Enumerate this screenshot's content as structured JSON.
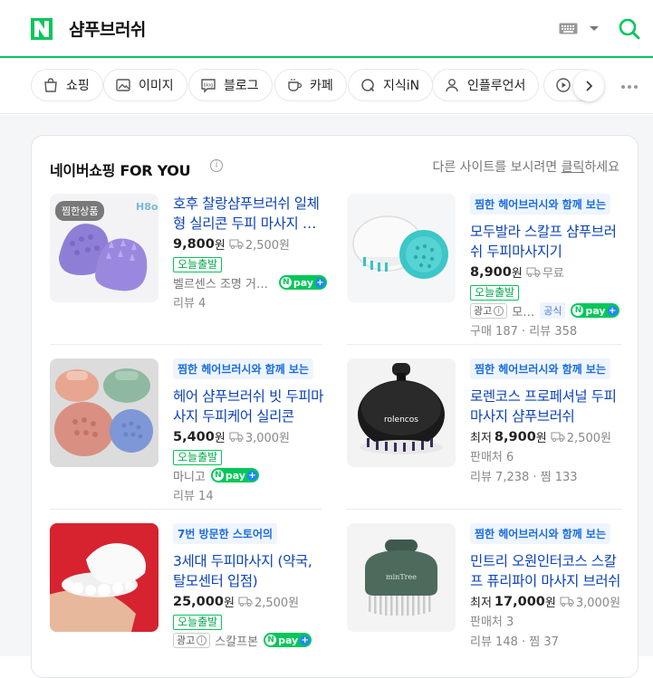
{
  "header": {
    "logo_letter": "N",
    "query": "샴푸브러쉬",
    "icons": [
      "keyboard-icon",
      "chevron-down-icon",
      "search-icon"
    ],
    "brand_color": "#03c75a"
  },
  "tabs": [
    {
      "label": "쇼핑",
      "icon": "shopping-bag-icon"
    },
    {
      "label": "이미지",
      "icon": "image-icon"
    },
    {
      "label": "블로그",
      "icon": "blog-icon"
    },
    {
      "label": "카페",
      "icon": "cafe-icon"
    },
    {
      "label": "지식iN",
      "icon": "kin-icon"
    },
    {
      "label": "인플루언서",
      "icon": "person-icon"
    },
    {
      "label": "",
      "icon": "play-icon"
    }
  ],
  "card": {
    "title": "네이버쇼핑 FOR YOU",
    "note_prefix": "다른 사이트를 보시려면 ",
    "note_link": "클릭",
    "note_suffix": "하세요"
  },
  "products": [
    {
      "thumb_badge": "찜한상품",
      "tagline": "",
      "title": "호후 찰랑샴푸브러쉬 일체형 실리콘 두피 마사지 샴푸브러쉬",
      "price_prefix": "",
      "price": "9,800",
      "won": "원",
      "shipping": "2,500원",
      "badge": "오늘출발",
      "ad": false,
      "seller": "벨르센스 조명 거실등",
      "official": "",
      "npay": true,
      "sub1": "리뷰 4",
      "sub2": ""
    },
    {
      "thumb_badge": "",
      "tagline": "찜한 헤어브러시와 함께 보는",
      "title": "모두발라 스칼프 샴푸브러쉬 두피마사지기",
      "price_prefix": "",
      "price": "8,900",
      "won": "원",
      "shipping": "무료",
      "badge": "오늘출발",
      "ad": true,
      "ad_label": "광고",
      "seller": "모…",
      "official": "공식",
      "npay": true,
      "sub1": "구매 187 · 리뷰 358",
      "sub2": ""
    },
    {
      "thumb_badge": "",
      "tagline": "찜한 헤어브러시와 함께 보는",
      "title": "헤어 샴푸브러쉬 빗 두피마사지 두피케어 실리콘",
      "price_prefix": "",
      "price": "5,400",
      "won": "원",
      "shipping": "3,000원",
      "badge": "오늘출발",
      "ad": false,
      "seller": "마니고",
      "official": "",
      "npay": true,
      "sub1": "리뷰 14",
      "sub2": ""
    },
    {
      "thumb_badge": "",
      "tagline": "찜한 헤어브러시와 함께 보는",
      "title": "로렌코스 프로페셔널 두피 마사지 샴푸브러쉬",
      "price_prefix": "최저",
      "price": "8,900",
      "won": "원",
      "shipping": "2,500원",
      "badge": "",
      "ad": false,
      "seller": "",
      "official": "",
      "npay": false,
      "sub1": "판매처 6",
      "sub2": "리뷰 7,238 · 찜 133"
    },
    {
      "thumb_badge": "",
      "tagline": "7번 방문한 스토어의",
      "title": "3세대 두피마사지 (약국, 탈모센터 입점)",
      "price_prefix": "",
      "price": "25,000",
      "won": "원",
      "shipping": "2,500원",
      "badge": "오늘출발",
      "ad": true,
      "ad_label": "광고",
      "seller": "스칼프본",
      "official": "",
      "npay": true,
      "sub1": "",
      "sub2": ""
    },
    {
      "thumb_badge": "",
      "tagline": "찜한 헤어브러시와 함께 보는",
      "title": "민트리 오원인터코스 스칼프 퓨리파이 마사지 브러쉬",
      "price_prefix": "최저",
      "price": "17,000",
      "won": "원",
      "shipping": "3,000원",
      "badge": "",
      "ad": false,
      "seller": "",
      "official": "",
      "npay": false,
      "sub1": "판매처 3",
      "sub2": "리뷰 148 · 찜 37"
    }
  ],
  "thumb_texts": {
    "p1_logo": "H8o",
    "p4_brand": "rolencos",
    "p6_brand": "minTree"
  }
}
